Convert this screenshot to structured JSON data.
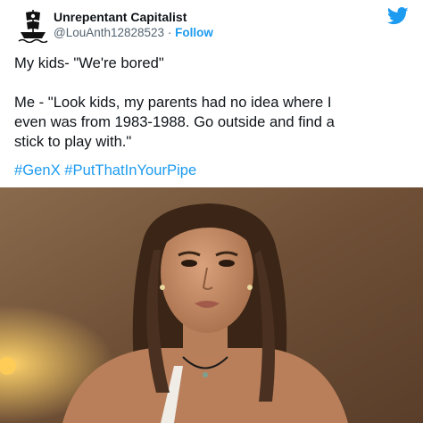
{
  "tweet": {
    "display_name": "Unrepentant Capitalist",
    "handle": "@LouAnth12828523",
    "separator": " · ",
    "follow_label": "Follow",
    "avatar_icon": "pirate-ship-icon",
    "brand_icon": "twitter-bird-icon",
    "body_lines": [
      "My kids- \"We're bored\"",
      "Me - \"Look kids, my parents had no idea where I",
      "even was from 1983-1988.  Go outside and find a",
      "stick to play with.\""
    ],
    "hashtags": [
      "#GenX",
      "#PutThatInYourPipe"
    ]
  },
  "colors": {
    "link": "#1d9bf0",
    "text": "#0f1419",
    "secondary": "#536471",
    "photo_wall": "#7a5a3e"
  },
  "photo": {
    "subject": "woman-portrait-photo"
  }
}
